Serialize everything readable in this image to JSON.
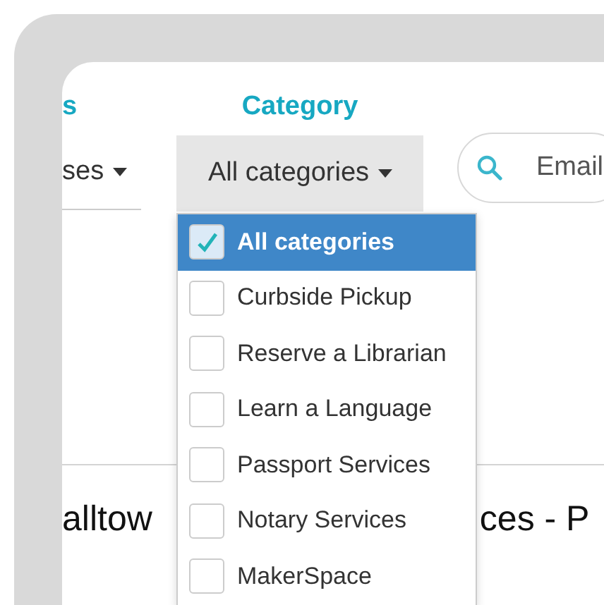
{
  "filters": [
    {
      "label": "s",
      "value": "ses"
    },
    {
      "label": "Category",
      "value": "All categories",
      "expanded": true
    }
  ],
  "search": {
    "placeholder": "Email"
  },
  "category_menu": [
    {
      "label": "All categories",
      "checked": true,
      "selected": true
    },
    {
      "label": "Curbside Pickup",
      "checked": false,
      "selected": false
    },
    {
      "label": "Reserve a Librarian",
      "checked": false,
      "selected": false
    },
    {
      "label": "Learn a Language",
      "checked": false,
      "selected": false
    },
    {
      "label": "Passport Services",
      "checked": false,
      "selected": false
    },
    {
      "label": "Notary Services",
      "checked": false,
      "selected": false
    },
    {
      "label": "MakerSpace",
      "checked": false,
      "selected": false
    }
  ],
  "heading": {
    "before_menu": "alltow",
    "after_menu": "ces - P"
  }
}
